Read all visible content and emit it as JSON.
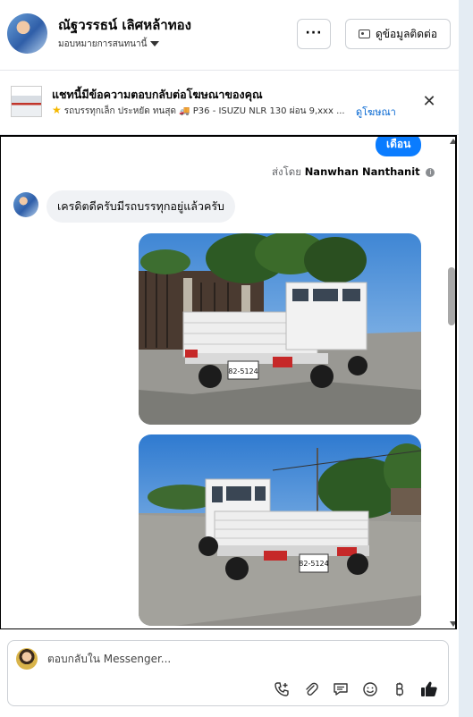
{
  "header": {
    "name": "ณัฐวรรธน์ เลิศหล้าทอง",
    "assign_label": "มอบหมายการสนทนานี้",
    "more_label": "···",
    "contact_label": "ดูข้อมูลติดต่อ"
  },
  "ad_banner": {
    "title": "แชทนี้มีข้อความตอบกลับต่อโฆษณาของคุณ",
    "subtitle": "รถบรรทุกเล็ก ประหยัด ทนสุด 🚚 P36 - ISUZU NLR 130 ผ่อน 9,xxx ...",
    "link_label": "ดูโฆษณา",
    "close_label": "✕"
  },
  "conversation": {
    "month_label": "เดือน",
    "sent_by_prefix": "ส่งโดย",
    "sent_by_name": "Nanwhan Nanthanit",
    "info_icon": "i",
    "messages": [
      {
        "type": "text",
        "text": "เครดิตดีครับมีรถบรรทุกอยู่แล้วครับ"
      }
    ],
    "photos": [
      {
        "plate": "82-5124"
      },
      {
        "plate": "82-5124"
      }
    ]
  },
  "composer": {
    "placeholder": "ตอบกลับใน Messenger...",
    "icons": [
      "phone-add-icon",
      "attachment-icon",
      "message-template-icon",
      "emoji-icon",
      "baht-payment-icon",
      "like-icon"
    ]
  }
}
